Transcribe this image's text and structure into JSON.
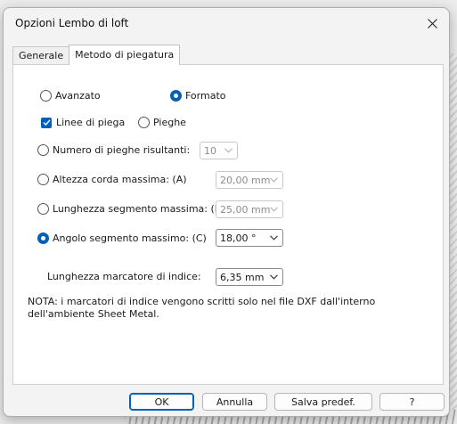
{
  "dialog": {
    "title": "Opzioni Lembo di loft"
  },
  "tabs": [
    {
      "label": "Generale",
      "active": false
    },
    {
      "label": "Metodo di piegatura",
      "active": true
    }
  ],
  "method": {
    "avanzato": {
      "label": "Avanzato",
      "selected": false
    },
    "formato": {
      "label": "Formato",
      "selected": true
    }
  },
  "lines": {
    "linee": {
      "label": "Linee di piega",
      "checked": true
    },
    "pieghe": {
      "label": "Pieghe",
      "selected": false
    }
  },
  "options": {
    "num_pieghe": {
      "label": "Numero di pieghe risultanti:",
      "value": "10",
      "selected": false,
      "enabled": false
    },
    "altezza_corda": {
      "label": "Altezza corda massima: (A)",
      "value": "20,00 mm",
      "selected": false,
      "enabled": false
    },
    "lunghezza_segmento": {
      "label": "Lunghezza segmento massima: (B)",
      "value": "25,00 mm",
      "selected": false,
      "enabled": false
    },
    "angolo_segmento": {
      "label": "Angolo segmento massimo: (C)",
      "value": "18,00 °",
      "selected": true,
      "enabled": true
    }
  },
  "marker": {
    "label": "Lunghezza marcatore di indice:",
    "value": "6,35 mm"
  },
  "note": "NOTA: i marcatori di indice vengono scritti solo nel file DXF dall'interno dell'ambiente Sheet Metal.",
  "buttons": {
    "ok": "OK",
    "annulla": "Annulla",
    "salva": "Salva predef.",
    "help": "?"
  },
  "colors": {
    "accent": "#005fb8",
    "panel": "#ffffff",
    "dialog": "#f3f3f3"
  }
}
